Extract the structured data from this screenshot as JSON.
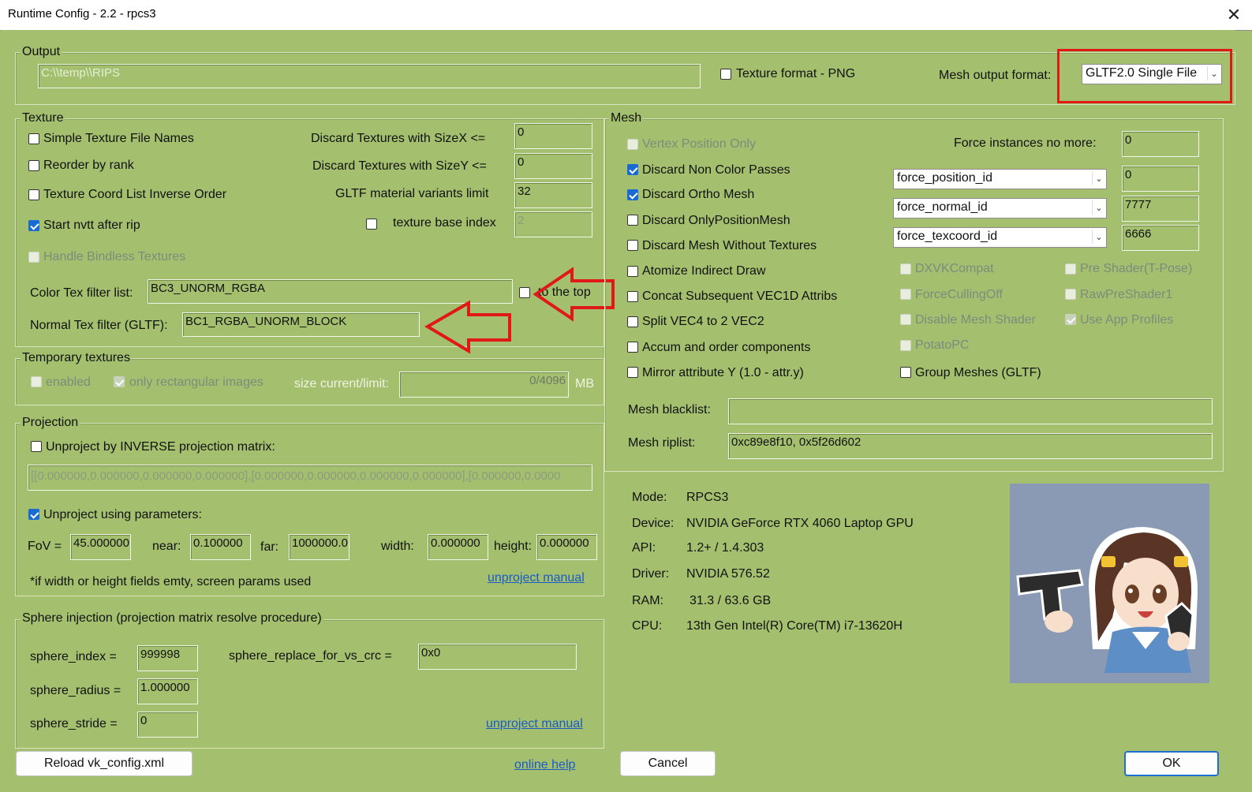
{
  "window": {
    "title": "Runtime Config - 2.2 - rpcs3",
    "close_glyph": "✕"
  },
  "output": {
    "legend": "Output",
    "path_value": "C:\\\\temp\\\\RIPS",
    "texture_png_label": "Texture format - PNG",
    "mesh_format_label": "Mesh output format:",
    "mesh_format_value": "GLTF2.0 Single File"
  },
  "texture": {
    "legend": "Texture",
    "simple_names": "Simple Texture File Names",
    "reorder": "Reorder by rank",
    "coord_inverse": "Texture Coord List Inverse Order",
    "start_nvtt": "Start nvtt after rip",
    "bindless": "Handle Bindless Textures",
    "discard_x_label": "Discard Textures with SizeX <=",
    "discard_x_value": "0",
    "discard_y_label": "Discard Textures with SizeY <=",
    "discard_y_value": "0",
    "variants_label": "GLTF material variants limit",
    "variants_value": "32",
    "base_index_label": "texture base index",
    "base_index_value": "2",
    "color_filter_label": "Color Tex filter list:",
    "color_filter_value": "BC3_UNORM_RGBA",
    "to_top_label": "to the top",
    "normal_filter_label": "Normal Tex filter (GLTF):",
    "normal_filter_value": "BC1_RGBA_UNORM_BLOCK"
  },
  "temporary": {
    "legend": "Temporary textures",
    "enabled": "enabled",
    "rect_only": "only rectangular images",
    "size_label": "size current/limit:",
    "size_value": "0/4096",
    "unit": "MB"
  },
  "projection": {
    "legend": "Projection",
    "inverse_label": "Unproject by INVERSE projection matrix:",
    "matrix_value": "[[0.000000,0.000000,0.000000,0.000000],[0.000000,0.000000,0.000000,0.000000],[0.000000,0.0000",
    "params_label": "Unproject using parameters:",
    "fov_label": "FoV =",
    "fov_value": "45.000000",
    "near_label": "near:",
    "near_value": "0.100000",
    "far_label": "far:",
    "far_value": "1000000.0",
    "width_label": "width:",
    "width_value": "0.000000",
    "height_label": "height:",
    "height_value": "0.000000",
    "note": "*if width or height fields emty, screen params used",
    "manual_link": "unproject manual"
  },
  "sphere": {
    "legend": "Sphere injection (projection matrix resolve procedure)",
    "index_label": "sphere_index =",
    "index_value": "999998",
    "replace_label": "sphere_replace_for_vs_crc =",
    "replace_value": "0x0",
    "radius_label": "sphere_radius =",
    "radius_value": "1.000000",
    "stride_label": "sphere_stride =",
    "stride_value": "0",
    "manual_link": "unproject manual"
  },
  "mesh": {
    "legend": "Mesh",
    "vertex_only": "Vertex Position Only",
    "discard_noncolor": "Discard Non Color Passes",
    "discard_ortho": "Discard Ortho Mesh",
    "discard_onlypos": "Discard OnlyPositionMesh",
    "discard_notex": "Discard Mesh Without Textures",
    "atomize": "Atomize Indirect Draw",
    "concat": "Concat Subsequent VEC1D Attribs",
    "split_vec4": "Split VEC4 to 2 VEC2",
    "accum": "Accum and order components",
    "mirror": "Mirror attribute Y (1.0 - attr.y)",
    "force_instances_label": "Force instances no more:",
    "force_instances_value": "0",
    "combo_pos": "force_position_id",
    "combo_pos_value": "0",
    "combo_norm": "force_normal_id",
    "combo_norm_value": "7777",
    "combo_tex": "force_texcoord_id",
    "combo_tex_value": "6666",
    "dxvk": "DXVKCompat",
    "culling": "ForceCullingOff",
    "disable_shader": "Disable Mesh Shader",
    "potato": "PotatoPC",
    "group_meshes": "Group Meshes (GLTF)",
    "pre_shader": "Pre Shader(T-Pose)",
    "raw_pre": "RawPreShader1",
    "app_profiles": "Use App Profiles",
    "blacklist_label": "Mesh blacklist:",
    "blacklist_value": "",
    "riplist_label": "Mesh riplist:",
    "riplist_value": "0xc89e8f10, 0x5f26d602"
  },
  "info": {
    "mode_label": "Mode:",
    "mode_value": "RPCS3",
    "device_label": "Device:",
    "device_value": "NVIDIA GeForce RTX 4060 Laptop GPU",
    "api_label": "API:",
    "api_value": "1.2+ / 1.4.303",
    "driver_label": "Driver:",
    "driver_value": "NVIDIA 576.52",
    "ram_label": "RAM:",
    "ram_value": "31.3 / 63.6 GB",
    "cpu_label": "CPU:",
    "cpu_value": "13th Gen Intel(R) Core(TM) i7-13620H"
  },
  "footer": {
    "reload": "Reload vk_config.xml",
    "help": "online help",
    "cancel": "Cancel",
    "ok": "OK"
  },
  "colors": {
    "background": "#a4c06f",
    "annotation_red": "#e01818",
    "checkbox_blue": "#1a6ad4"
  }
}
